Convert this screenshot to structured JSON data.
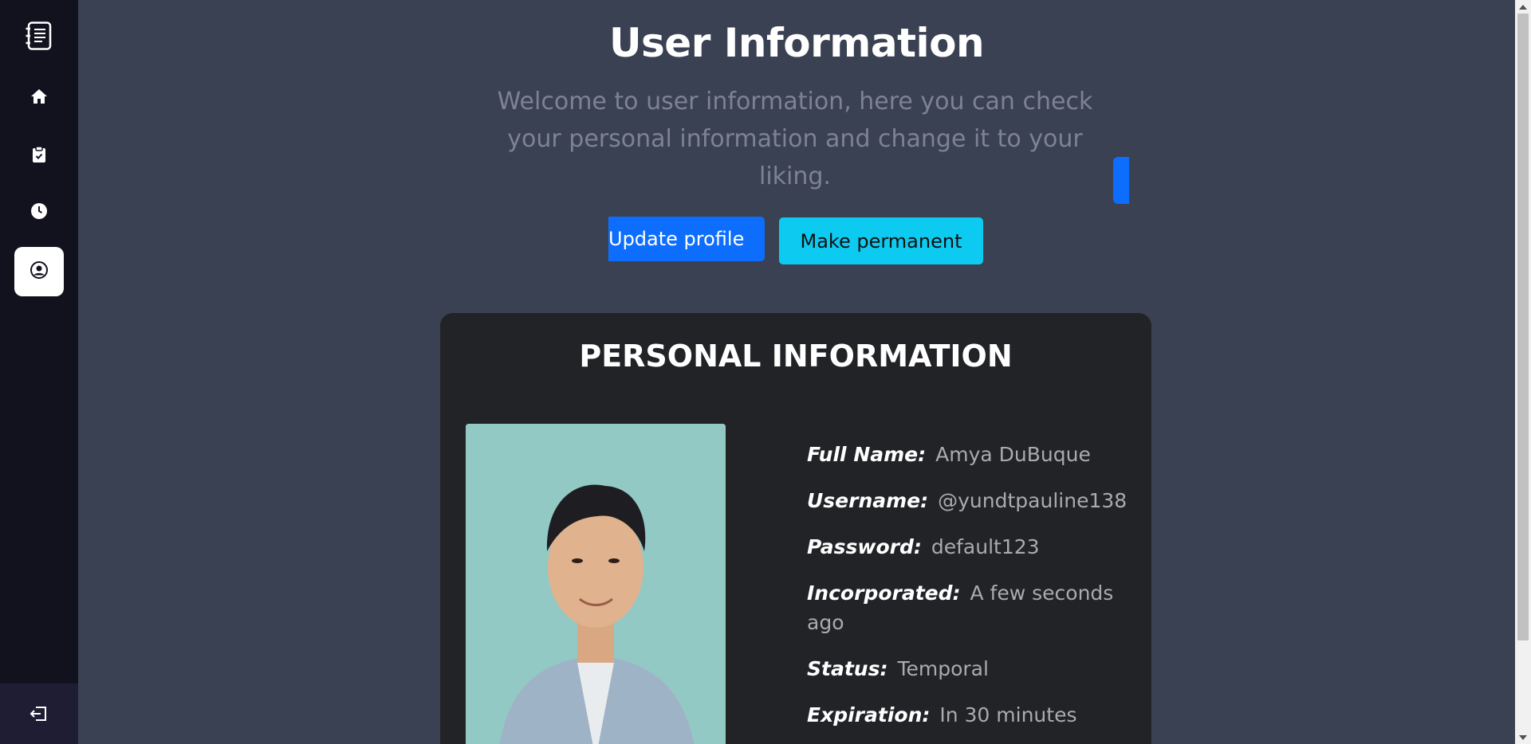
{
  "header": {
    "title": "User Information",
    "subtitle": "Welcome to user information, here you can check your personal information and change it to your liking."
  },
  "actions": {
    "update_label": "Update profile",
    "permanent_label": "Make permanent"
  },
  "card": {
    "title": "PERSONAL INFORMATION",
    "fields": [
      {
        "label": "Full Name:",
        "value": "Amya DuBuque"
      },
      {
        "label": "Username:",
        "value": "@yundtpauline138"
      },
      {
        "label": "Password:",
        "value": "default123"
      },
      {
        "label": "Incorporated:",
        "value": "A few seconds ago"
      },
      {
        "label": "Status:",
        "value": "Temporal"
      },
      {
        "label": "Expiration:",
        "value": "In 30 minutes"
      }
    ]
  },
  "sidebar": {
    "items": [
      {
        "icon": "home-icon"
      },
      {
        "icon": "clipboard-check-icon"
      },
      {
        "icon": "clock-icon"
      },
      {
        "icon": "user-circle-icon",
        "active": true
      }
    ]
  },
  "colors": {
    "background": "#3a4152",
    "sidebar": "#12121f",
    "card": "#222327",
    "primary": "#0d6efd",
    "info": "#0dcaf0"
  }
}
